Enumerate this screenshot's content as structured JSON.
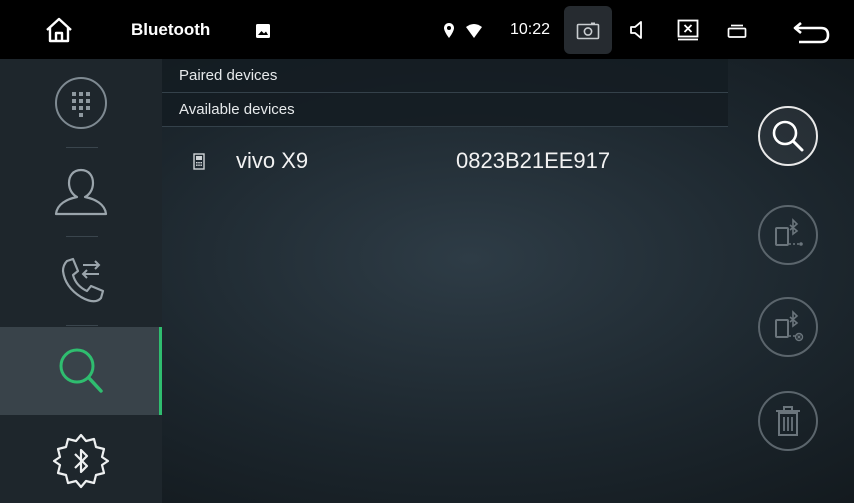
{
  "statusbar": {
    "title": "Bluetooth",
    "time": "10:22",
    "icons": [
      "home-icon",
      "image-icon",
      "location-icon",
      "wifi-icon",
      "screenshot-icon",
      "volume-icon",
      "close-window-icon",
      "recent-apps-icon",
      "back-icon"
    ]
  },
  "sidebar": {
    "items": [
      {
        "icon": "dialpad-icon",
        "active": false
      },
      {
        "icon": "contacts-icon",
        "active": false
      },
      {
        "icon": "call-log-icon",
        "active": false
      },
      {
        "icon": "search-icon",
        "active": true
      },
      {
        "icon": "bluetooth-settings-icon",
        "active": false
      }
    ]
  },
  "lists": {
    "paired_label": "Paired devices",
    "available_label": "Available devices"
  },
  "devices": [
    {
      "name": "vivo X9",
      "address": "0823B21EE917",
      "icon": "phone-icon"
    }
  ],
  "actions": [
    {
      "icon": "search-icon",
      "state": "enabled"
    },
    {
      "icon": "bluetooth-connect-icon",
      "state": "disabled"
    },
    {
      "icon": "bluetooth-disconnect-icon",
      "state": "disabled"
    },
    {
      "icon": "trash-icon",
      "state": "disabled"
    }
  ],
  "colors": {
    "accent": "#2fbd6f",
    "sidebar": "#1e262c",
    "active": "#39434a"
  }
}
